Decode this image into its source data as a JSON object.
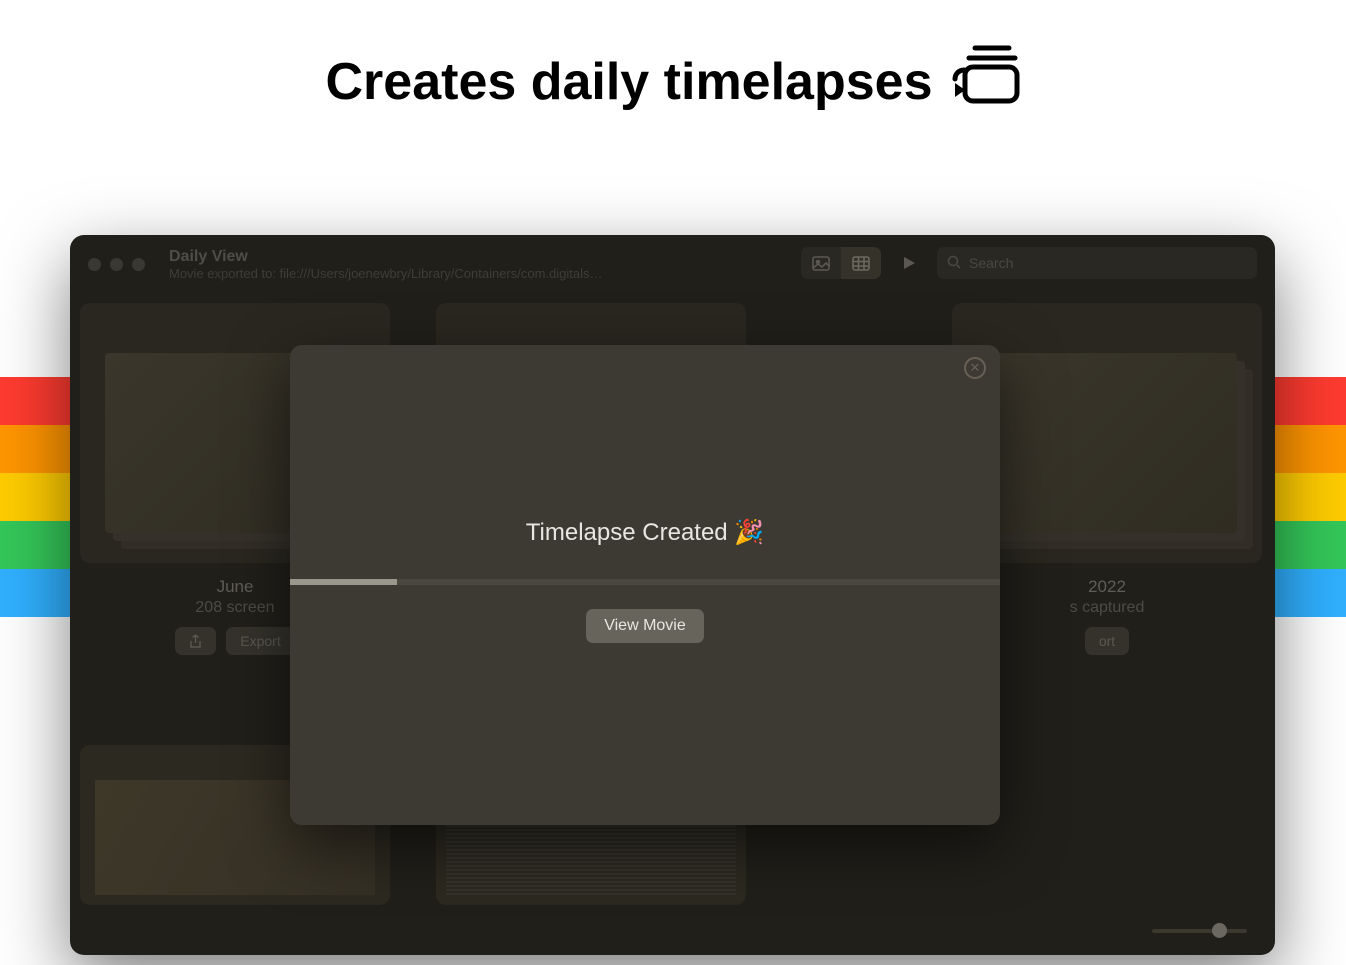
{
  "hero": {
    "title": "Creates daily timelapses"
  },
  "window": {
    "title": "Daily View",
    "subtitle": "Movie exported to: file:///Users/joenewbry/Library/Containers/com.digitals…",
    "search_placeholder": "Search"
  },
  "cards": [
    {
      "date": "June",
      "sub": "208 screen",
      "share_label": "",
      "export_label": "Export"
    },
    {
      "date": "",
      "sub": "",
      "share_label": "",
      "export_label": ""
    },
    {
      "date": "2022",
      "sub": "s captured",
      "share_label": "",
      "export_label": "ort"
    }
  ],
  "modal": {
    "title": "Timelapse Created 🎉",
    "button": "View Movie",
    "progress_percent": 15
  }
}
